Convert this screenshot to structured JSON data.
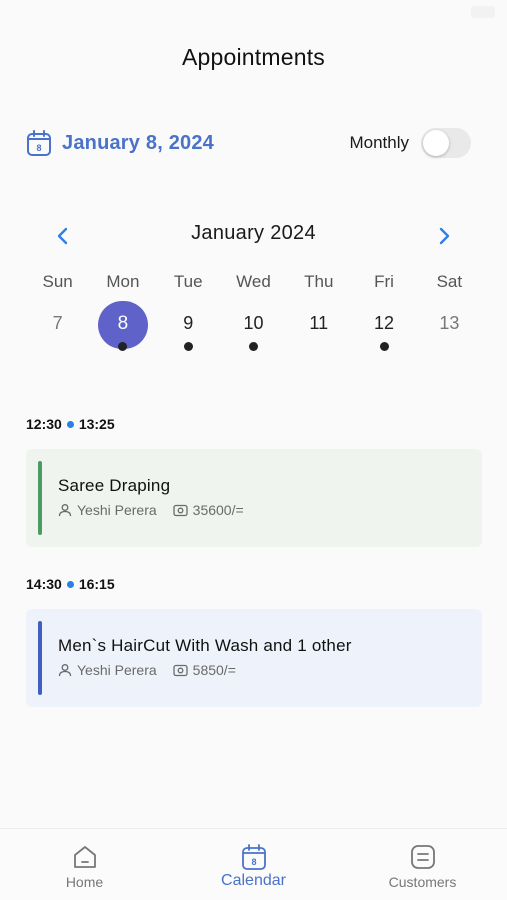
{
  "header": {
    "title": "Appointments"
  },
  "date_bar": {
    "selected_date": "January 8, 2024",
    "calendar_icon_day": "8",
    "view_mode_label": "Monthly",
    "monthly_toggle_on": false
  },
  "calendar": {
    "month_title": "January 2024",
    "weekdays": [
      "Sun",
      "Mon",
      "Tue",
      "Wed",
      "Thu",
      "Fri",
      "Sat"
    ],
    "days": [
      {
        "num": "7",
        "selected": false,
        "has_event": false
      },
      {
        "num": "8",
        "selected": true,
        "has_event": true
      },
      {
        "num": "9",
        "selected": false,
        "has_event": true
      },
      {
        "num": "10",
        "selected": false,
        "has_event": true
      },
      {
        "num": "11",
        "selected": false,
        "has_event": false
      },
      {
        "num": "12",
        "selected": false,
        "has_event": true
      },
      {
        "num": "13",
        "selected": false,
        "has_event": false
      }
    ]
  },
  "appointments": [
    {
      "start": "12:30",
      "end": "13:25",
      "service": "Saree Draping",
      "staff": "Yeshi Perera",
      "price": "35600/=",
      "accent": "#4c9b63"
    },
    {
      "start": "14:30",
      "end": "16:15",
      "service": "Men`s HairCut With Wash and 1 other",
      "staff": "Yeshi Perera",
      "price": "5850/=",
      "accent": "#3f5fc4"
    }
  ],
  "tabbar": {
    "home": "Home",
    "calendar": "Calendar",
    "calendar_icon_day": "8",
    "customers": "Customers"
  },
  "colors": {
    "accent": "#4a72c9",
    "selected_day": "#5f63c9",
    "time_dot": "#2a7fe0"
  }
}
